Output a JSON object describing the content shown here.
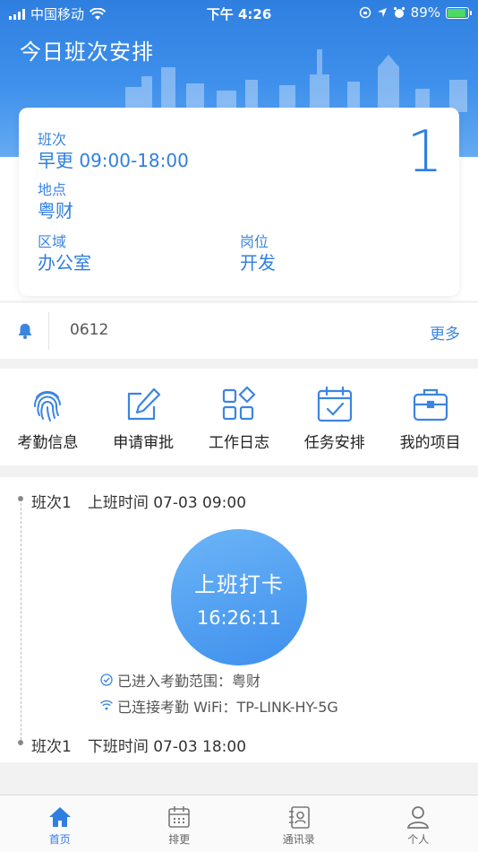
{
  "status_bar": {
    "carrier": "中国移动",
    "time": "下午 4:26",
    "battery": "89%"
  },
  "header": {
    "title": "今日班次安排"
  },
  "shift_card": {
    "shift_label": "班次",
    "shift_value": "早更 09:00-18:00",
    "location_label": "地点",
    "location_value": "粤财",
    "area_label": "区域",
    "area_value": "办公室",
    "post_label": "岗位",
    "post_value": "开发",
    "count": "1"
  },
  "notice": {
    "text": "0612",
    "more": "更多"
  },
  "menu": {
    "items": [
      {
        "label": "考勤信息",
        "icon": "fingerprint-icon"
      },
      {
        "label": "申请审批",
        "icon": "edit-icon"
      },
      {
        "label": "工作日志",
        "icon": "apps-icon"
      },
      {
        "label": "任务安排",
        "icon": "calendar-check-icon"
      },
      {
        "label": "我的项目",
        "icon": "briefcase-icon"
      }
    ]
  },
  "attendance": {
    "start_shift": "班次1",
    "start_time": "上班时间 07-03 09:00",
    "punch_label": "上班打卡",
    "punch_time": "16:26:11",
    "range_info": "已进入考勤范围：粤财",
    "wifi_info": "已连接考勤 WiFi：TP-LINK-HY-5G",
    "end_shift": "班次1",
    "end_time": "下班时间 07-03 18:00"
  },
  "tabbar": {
    "items": [
      {
        "label": "首页",
        "icon": "home-icon",
        "active": true
      },
      {
        "label": "排更",
        "icon": "calendar-icon",
        "active": false
      },
      {
        "label": "通讯录",
        "icon": "contacts-icon",
        "active": false
      },
      {
        "label": "个人",
        "icon": "user-icon",
        "active": false
      }
    ]
  },
  "colors": {
    "accent": "#2f7fe0",
    "background": "#f2f2f2"
  }
}
